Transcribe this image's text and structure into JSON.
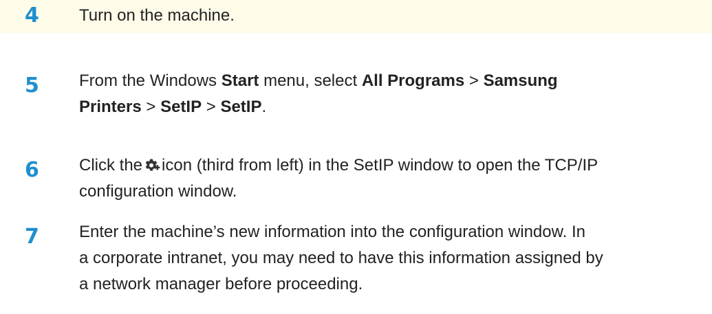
{
  "steps": [
    {
      "number": "4",
      "lines": [
        {
          "segments": [
            {
              "text": "Turn on the machine.",
              "bold": false
            }
          ]
        }
      ]
    },
    {
      "number": "5",
      "lines": [
        {
          "segments": [
            {
              "text": "From the Windows ",
              "bold": false
            },
            {
              "text": "Start",
              "bold": true
            },
            {
              "text": " menu, select ",
              "bold": false
            },
            {
              "text": "All Programs",
              "bold": true
            },
            {
              "text": " > ",
              "bold": false
            },
            {
              "text": "Samsung",
              "bold": true
            }
          ]
        },
        {
          "segments": [
            {
              "text": "Printers",
              "bold": true
            },
            {
              "text": " > ",
              "bold": false
            },
            {
              "text": "SetIP",
              "bold": true
            },
            {
              "text": " > ",
              "bold": false
            },
            {
              "text": "SetIP",
              "bold": true
            },
            {
              "text": ".",
              "bold": false
            }
          ]
        }
      ]
    },
    {
      "number": "6",
      "lines": [
        {
          "segments": [
            {
              "text": "Click the",
              "bold": false
            },
            {
              "icon": "tcp-ip-config-gear-icon"
            },
            {
              "text": "icon (third from left) in the SetIP window to open the TCP/IP",
              "bold": false
            }
          ]
        },
        {
          "segments": [
            {
              "text": "configuration window.",
              "bold": false
            }
          ]
        }
      ]
    },
    {
      "number": "7",
      "lines": [
        {
          "segments": [
            {
              "text": "Enter the machine’s new information into the configuration window. In",
              "bold": false
            }
          ]
        },
        {
          "segments": [
            {
              "text": "a corporate intranet, you may need to have this information assigned by",
              "bold": false
            }
          ]
        },
        {
          "segments": [
            {
              "text": "a network manager before proceeding.",
              "bold": false
            }
          ]
        }
      ]
    }
  ],
  "colors": {
    "step_number": "#1f8fcf",
    "body_text": "#222222",
    "top_band": "#fffbe9",
    "icon": "#333333"
  }
}
